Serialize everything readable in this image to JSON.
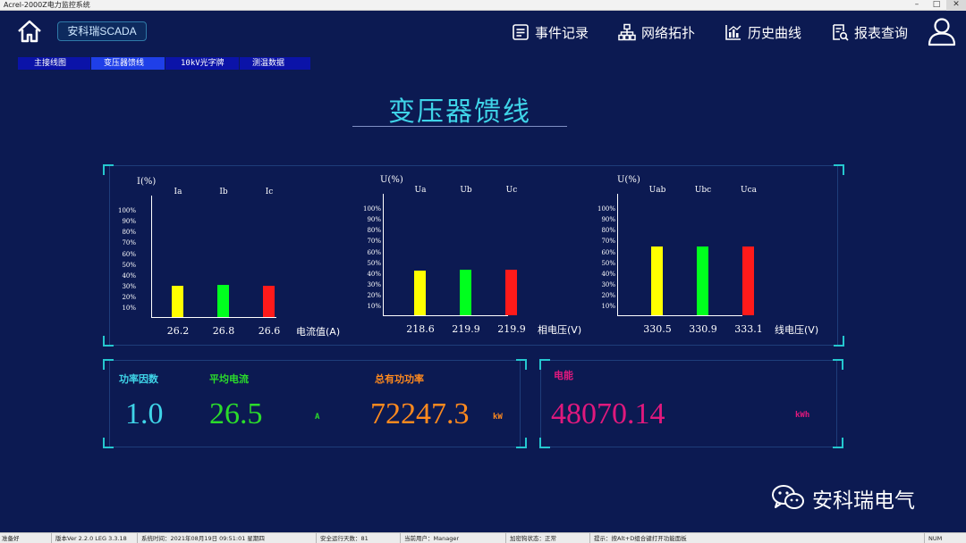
{
  "window": {
    "title": "Acrel-2000Z电力监控系统",
    "minimize": "–",
    "maximize": "□",
    "close": "✕"
  },
  "header": {
    "home_icon": "home-icon",
    "brand": "安科瑞SCADA",
    "nav": [
      {
        "label": "事件记录",
        "icon": "event-log-icon"
      },
      {
        "label": "网络拓扑",
        "icon": "network-topology-icon"
      },
      {
        "label": "历史曲线",
        "icon": "history-chart-icon"
      },
      {
        "label": "报表查询",
        "icon": "report-search-icon"
      }
    ],
    "user_icon": "user-icon"
  },
  "tabs": [
    {
      "label": "主接线图",
      "active": false
    },
    {
      "label": "变压器馈线",
      "active": true
    },
    {
      "label": "10kV光字牌",
      "active": false
    },
    {
      "label": "测温数据",
      "active": false
    }
  ],
  "page_title": "变压器馈线",
  "chart_data": [
    {
      "type": "bar",
      "unit_label": "I(%)",
      "y_ticks": [
        "100%",
        "90%",
        "80%",
        "70%",
        "60%",
        "50%",
        "40%",
        "30%",
        "20%",
        "10%"
      ],
      "categories": [
        "Ia",
        "Ib",
        "Ic"
      ],
      "values": [
        30,
        31,
        30
      ],
      "value_labels": [
        "26.2",
        "26.8",
        "26.6"
      ],
      "colors": [
        "#ffff00",
        "#00ff1e",
        "#ff1a1a"
      ],
      "xlabel": "电流值(A)",
      "ylim": [
        0,
        100
      ]
    },
    {
      "type": "bar",
      "unit_label": "U(%)",
      "y_ticks": [
        "100%",
        "90%",
        "80%",
        "70%",
        "60%",
        "50%",
        "40%",
        "30%",
        "20%",
        "10%"
      ],
      "categories": [
        "Ua",
        "Ub",
        "Uc"
      ],
      "values": [
        43,
        44,
        44
      ],
      "value_labels": [
        "218.6",
        "219.9",
        "219.9"
      ],
      "colors": [
        "#ffff00",
        "#00ff1e",
        "#ff1a1a"
      ],
      "xlabel": "相电压(V)",
      "ylim": [
        0,
        100
      ]
    },
    {
      "type": "bar",
      "unit_label": "U(%)",
      "y_ticks": [
        "100%",
        "90%",
        "80%",
        "70%",
        "60%",
        "50%",
        "40%",
        "30%",
        "20%",
        "10%"
      ],
      "categories": [
        "Uab",
        "Ubc",
        "Uca"
      ],
      "values": [
        66,
        66,
        66
      ],
      "value_labels": [
        "330.5",
        "330.9",
        "333.1"
      ],
      "colors": [
        "#ffff00",
        "#00ff1e",
        "#ff1a1a"
      ],
      "xlabel": "线电压(V)",
      "ylim": [
        0,
        100
      ]
    }
  ],
  "metrics": {
    "power_factor": {
      "label": "功率因数",
      "value": "1.0",
      "color": "#3fd4e8"
    },
    "avg_current": {
      "label": "平均电流",
      "value": "26.5",
      "unit": "A",
      "color": "#2bdc2b"
    },
    "total_active_power": {
      "label": "总有功功率",
      "value": "72247.3",
      "unit": "kW",
      "color": "#ff8a1e"
    },
    "energy": {
      "label": "电能",
      "value": "48070.14",
      "unit": "kWh",
      "color": "#e0197d"
    }
  },
  "watermark": {
    "label": "安科瑞电气",
    "icon": "wechat-icon"
  },
  "statusbar": [
    "准备好",
    "版本Ver 2.2.0 LEG 3.3.18",
    "系统时间：2021年08月19日  09:51:01  星期四",
    "安全运行天数：81",
    "当前用户：Manager",
    "加密狗状态：正常",
    "提示：按Alt+D组合键打开功能面板",
    "NUM"
  ]
}
